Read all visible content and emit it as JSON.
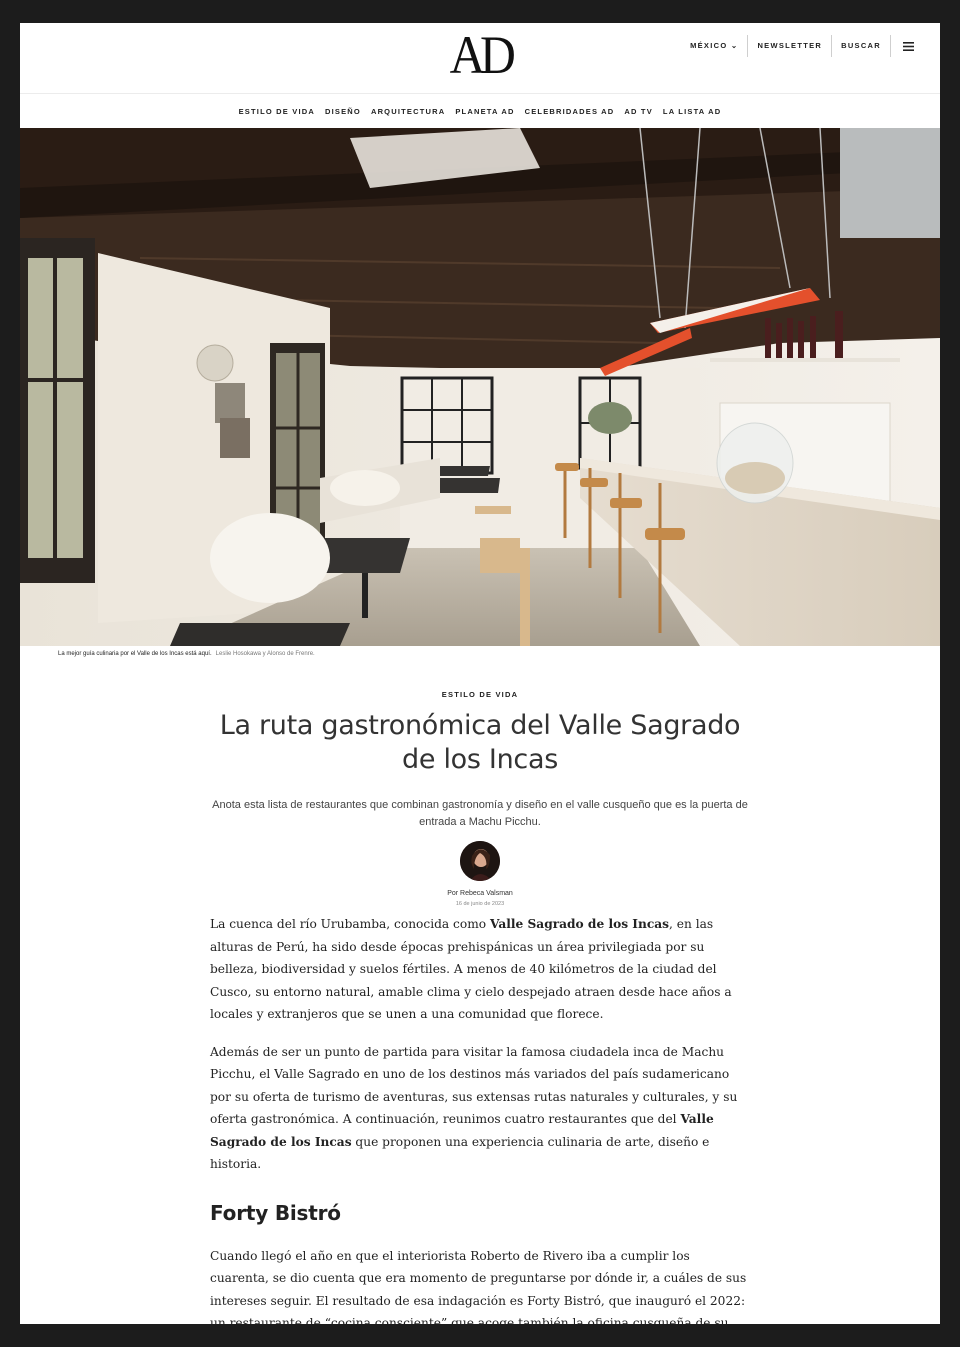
{
  "header": {
    "logo": "AD",
    "util": {
      "region": "MÉXICO ⌄",
      "newsletter": "NEWSLETTER",
      "search": "BUSCAR"
    },
    "nav": [
      "ESTILO DE VIDA",
      "DISEÑO",
      "ARQUITECTURA",
      "PLANETA AD",
      "CELEBRIDADES AD",
      "AD TV",
      "LA LISTA AD"
    ]
  },
  "hero": {
    "caption": "La mejor guía culinaria por el Valle de los Incas está aquí.",
    "credit": "Leslie Hosokawa y Alonso de Frenre."
  },
  "article": {
    "rubric": "ESTILO DE VIDA",
    "title": "La ruta gastronómica del Valle Sagrado de los Incas",
    "dek": "Anota esta lista de restaurantes que combinan gastronomía y diseño en el valle cusqueño que es la puerta de entrada a Machu Picchu.",
    "author": "Por Rebeca Valsman",
    "date": "16 de junio de 2023",
    "p1": {
      "a": "La cuenca del río Urubamba, conocida como ",
      "b": "Valle Sagrado de los Incas",
      "c": ", en las alturas de Perú, ha sido desde épocas prehispánicas un área privilegiada por su belleza, biodiversidad y suelos fértiles. A menos de 40 kilómetros de la ciudad del Cusco, su entorno natural, amable clima y cielo despejado atraen desde hace años a locales y extranjeros que se unen a una comunidad que florece."
    },
    "p2": {
      "a": "Además de ser un punto de partida para visitar la famosa ciudadela inca de Machu Picchu, el Valle Sagrado en uno de los destinos más variados del país sudamericano por su oferta de turismo de aventuras, sus extensas rutas naturales y culturales, y su oferta gastronómica. A continuación, reunimos cuatro restaurantes que del ",
      "b": "Valle Sagrado de los Incas",
      "c": " que proponen una experiencia culinaria de arte, diseño e historia."
    },
    "h2": "Forty Bistró",
    "p3": "Cuando llegó el año en que el interiorista Roberto de Rivero iba a cumplir los cuarenta, se dio cuenta que era momento de preguntarse por dónde ir, a cuáles de sus intereses seguir. El resultado de esa indagación es Forty Bistró, que inauguró el 2022: un restaurante de “cocina consciente” que acoge también la oficina cusqueña de su"
  }
}
